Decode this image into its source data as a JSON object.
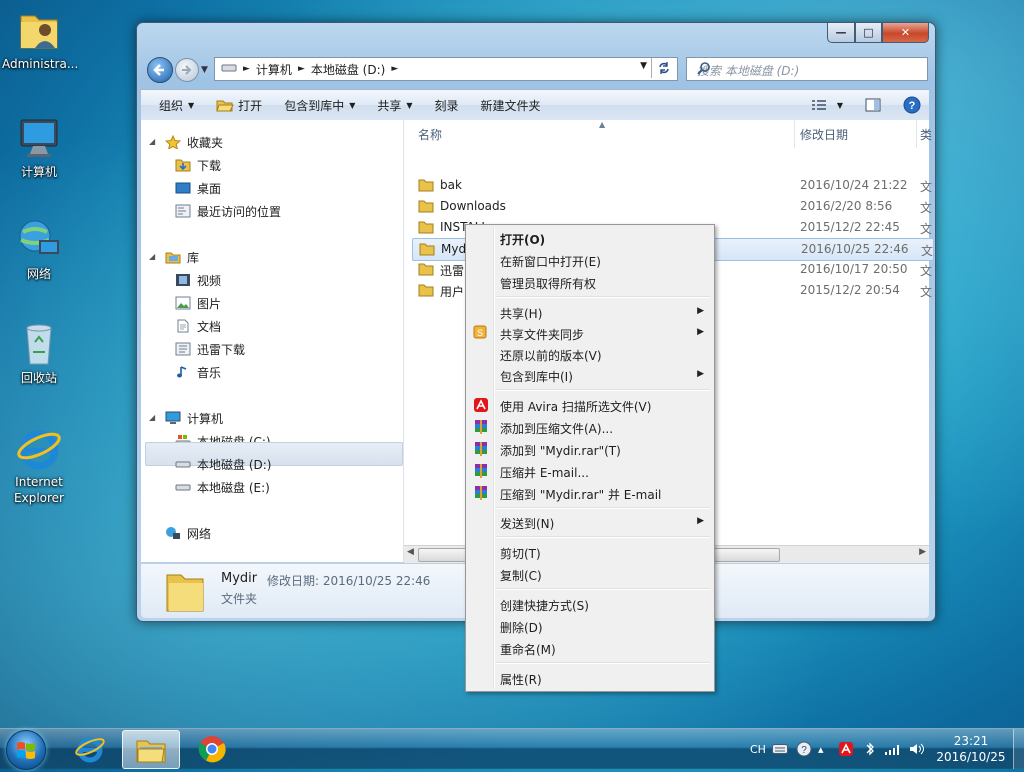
{
  "desktop": {
    "icons": [
      {
        "label": "Administra...",
        "icon": "user-folder-icon"
      },
      {
        "label": "计算机",
        "icon": "computer-icon"
      },
      {
        "label": "网络",
        "icon": "network-icon"
      },
      {
        "label": "回收站",
        "icon": "recycle-bin-icon"
      },
      {
        "label_line1": "Internet",
        "label_line2": "Explorer",
        "icon": "ie-icon"
      }
    ]
  },
  "explorer": {
    "breadcrumb": [
      "计算机",
      "本地磁盘 (D:)"
    ],
    "search_placeholder": "搜索 本地磁盘 (D:)",
    "toolbar": {
      "organize": "组织",
      "open": "打开",
      "include_in_library": "包含到库中",
      "share": "共享",
      "burn": "刻录",
      "new_folder": "新建文件夹"
    },
    "nav": {
      "favorites": "收藏夹",
      "downloads": "下载",
      "desktop": "桌面",
      "recent": "最近访问的位置",
      "libraries": "库",
      "videos": "视频",
      "pictures": "图片",
      "documents": "文档",
      "xunlei": "迅雷下载",
      "music": "音乐",
      "computer": "计算机",
      "disk_c": "本地磁盘 (C:)",
      "disk_d": "本地磁盘 (D:)",
      "disk_e": "本地磁盘 (E:)",
      "network": "网络"
    },
    "columns": {
      "name": "名称",
      "modified": "修改日期",
      "type": "类"
    },
    "files": [
      {
        "name": "bak",
        "date": "2016/10/24 21:22",
        "type": "文"
      },
      {
        "name": "Downloads",
        "date": "2016/2/20 8:56",
        "type": "文"
      },
      {
        "name": "INSTALL",
        "date": "2015/12/2 22:45",
        "type": "文"
      },
      {
        "name": "Mydir",
        "date": "2016/10/25 22:46",
        "type": "文"
      },
      {
        "name": "迅雷",
        "date": "2016/10/17 20:50",
        "type": "文"
      },
      {
        "name": "用户",
        "date": "2015/12/2 20:54",
        "type": "文"
      }
    ],
    "details": {
      "name": "Mydir",
      "modified": "修改日期: 2016/10/25 22:46",
      "type": "文件夹"
    }
  },
  "context_menu": {
    "open": "打开(O)",
    "open_new_window": "在新窗口中打开(E)",
    "take_ownership": "管理员取得所有权",
    "share": "共享(H)",
    "sync_share": "共享文件夹同步",
    "restore": "还原以前的版本(V)",
    "include_library": "包含到库中(I)",
    "avira": "使用 Avira 扫描所选文件(V)",
    "add_archive": "添加到压缩文件(A)...",
    "add_rar": "添加到 \"Mydir.rar\"(T)",
    "compress_email": "压缩并 E-mail...",
    "compress_rar_email": "压缩到 \"Mydir.rar\" 并 E-mail",
    "send_to": "发送到(N)",
    "cut": "剪切(T)",
    "copy": "复制(C)",
    "shortcut": "创建快捷方式(S)",
    "delete": "删除(D)",
    "rename": "重命名(M)",
    "properties": "属性(R)"
  },
  "taskbar": {
    "lang": "CH",
    "time": "23:21",
    "date": "2016/10/25"
  },
  "colors": {
    "accent": "#1f6fb8",
    "selection": "#d6e6f8",
    "close_button": "#c7482a"
  }
}
